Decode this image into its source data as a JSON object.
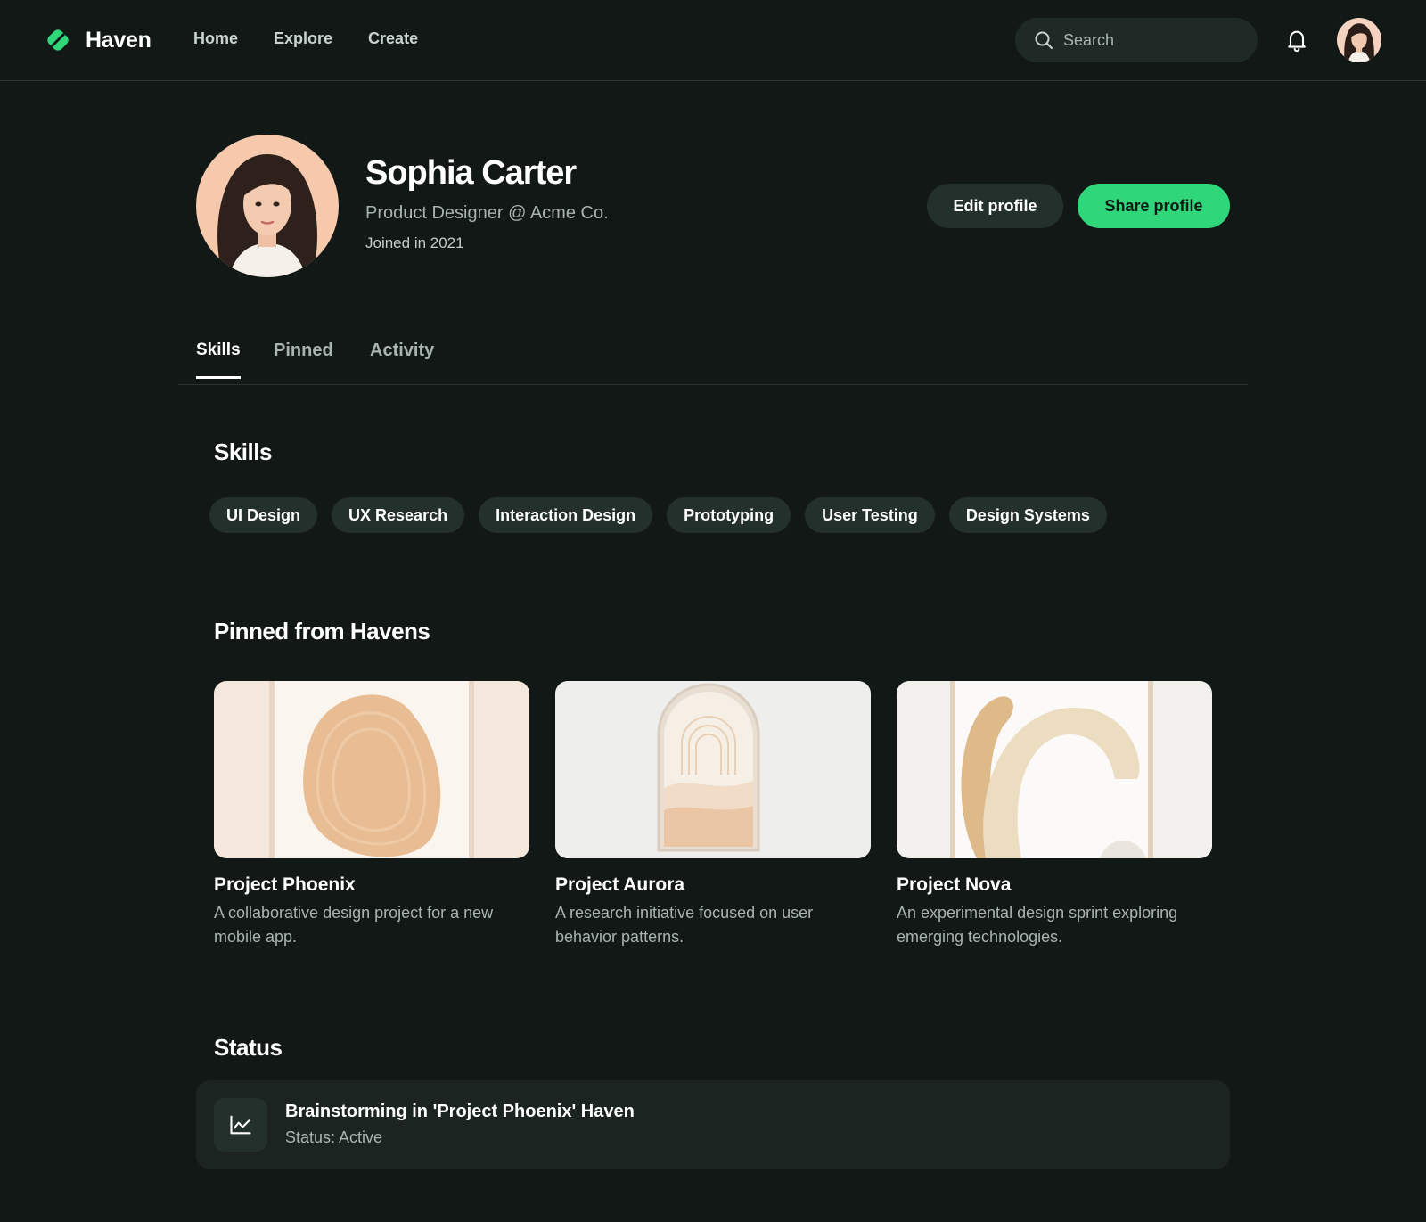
{
  "brand": {
    "name": "Haven",
    "accent": "#2fd67a"
  },
  "nav": {
    "items": [
      "Home",
      "Explore",
      "Create"
    ]
  },
  "search": {
    "placeholder": "Search"
  },
  "icons": {
    "search": "search-icon",
    "notifications": "bell-icon",
    "status": "line-chart-icon"
  },
  "profile": {
    "name": "Sophia Carter",
    "role": "Product Designer @ Acme Co.",
    "joined": "Joined in 2021",
    "edit_label": "Edit profile",
    "share_label": "Share profile"
  },
  "tabs": [
    {
      "label": "Skills",
      "active": true
    },
    {
      "label": "Pinned",
      "active": false
    },
    {
      "label": "Activity",
      "active": false
    }
  ],
  "skills": {
    "title": "Skills",
    "items": [
      "UI Design",
      "UX Research",
      "Interaction Design",
      "Prototyping",
      "User Testing",
      "Design Systems"
    ]
  },
  "pinned": {
    "title": "Pinned from Havens",
    "cards": [
      {
        "title": "Project Phoenix",
        "description": "A collaborative design project for a new mobile app."
      },
      {
        "title": "Project Aurora",
        "description": "A research initiative focused on user behavior patterns."
      },
      {
        "title": "Project Nova",
        "description": "An experimental design sprint exploring emerging technologies."
      }
    ]
  },
  "status": {
    "title": "Status",
    "item_title": "Brainstorming in 'Project Phoenix' Haven",
    "item_status": "Status: Active"
  }
}
